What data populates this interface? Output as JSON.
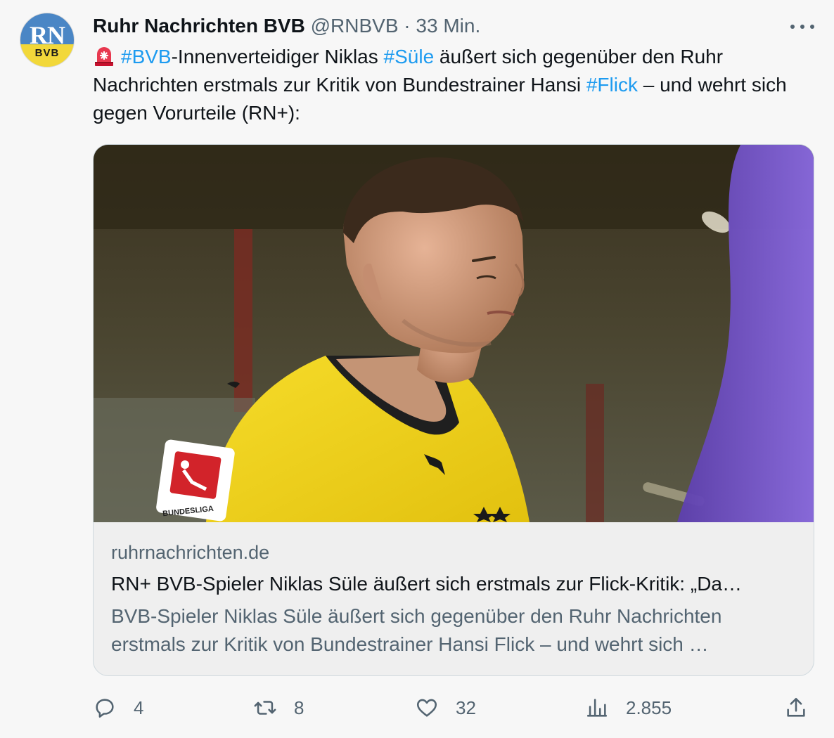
{
  "tweet": {
    "author_name": "Ruhr Nachrichten BVB",
    "handle": "@RNBVB",
    "separator": "·",
    "time": "33 Min.",
    "avatar": {
      "line1": "RN",
      "line2": "BVB"
    },
    "text_parts": {
      "tag_bvb": "#BVB",
      "t1": "-Innenverteidiger Niklas ",
      "tag_suele": "#Süle",
      "t2": " äußert sich gegenüber den Ruhr Nachrichten erstmals zur Kritik von Bundestrainer Hansi ",
      "tag_flick": "#Flick",
      "t3": " – und wehrt sich gegen Vorurteile (RN+):"
    },
    "emoji": "siren-icon"
  },
  "card": {
    "image_alt": "BVB-Spieler Niklas Süle im gelben Trikot",
    "domain": "ruhrnachrichten.de",
    "title": "RN+ BVB-Spieler Niklas Süle äußert sich erstmals zur Flick-Kritik: „Da…",
    "description": "BVB-Spieler Niklas Süle äußert sich gegenüber den Ruhr Nachrichten erstmals zur Kritik von Bundestrainer Hansi Flick – und wehrt sich …",
    "patch_text": "BUNDESLIGA"
  },
  "actions": {
    "reply_count": "4",
    "retweet_count": "8",
    "like_count": "32",
    "views_count": "2.855"
  },
  "colors": {
    "link": "#1d9bf0",
    "secondary_text": "#536471",
    "jersey": "#f5d51f"
  }
}
